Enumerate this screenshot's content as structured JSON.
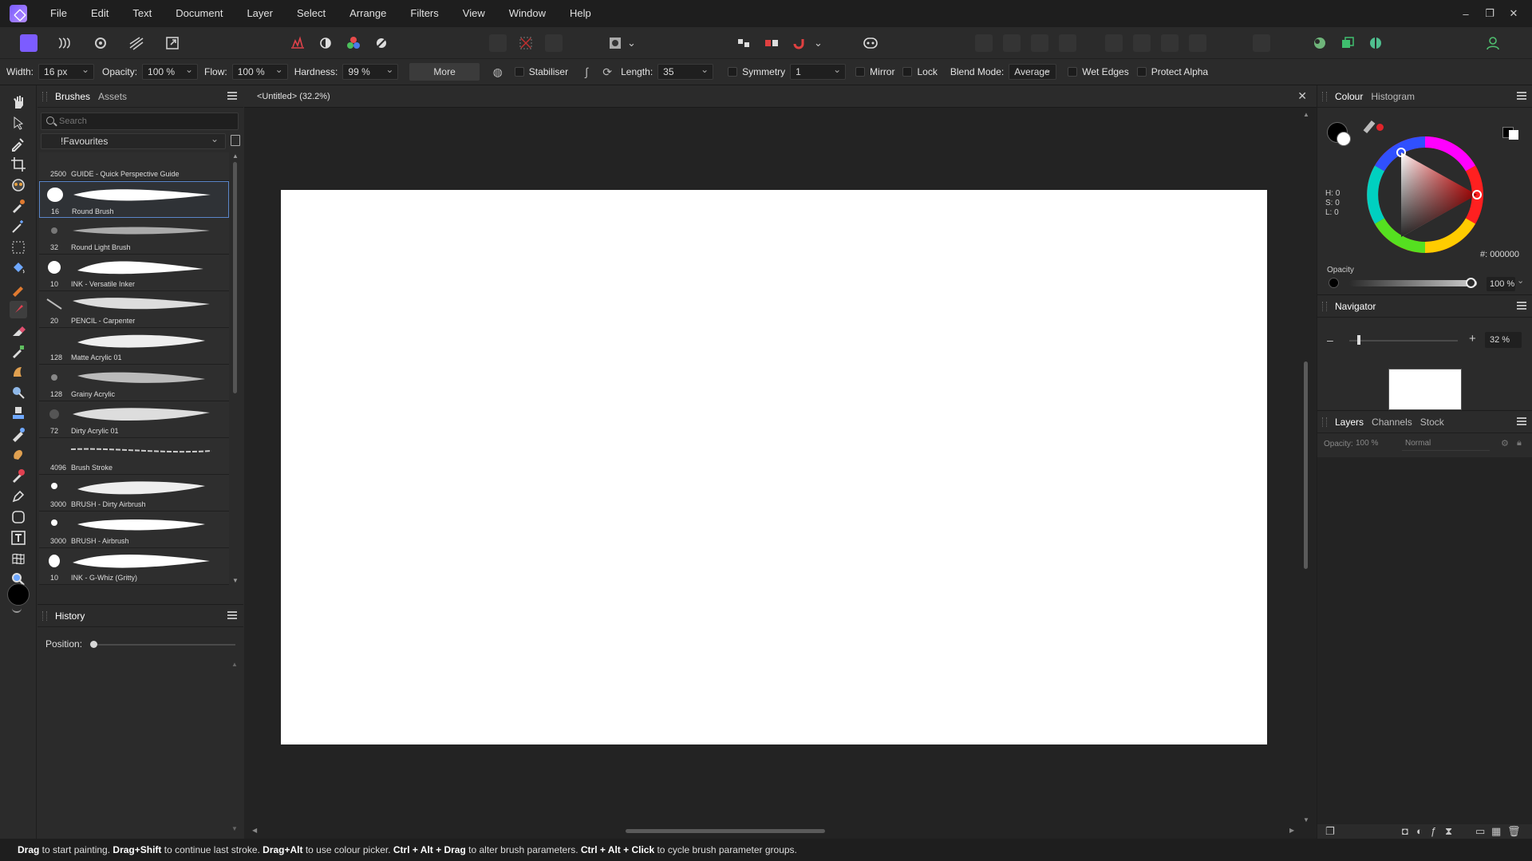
{
  "menu": {
    "items": [
      "File",
      "Edit",
      "Text",
      "Document",
      "Layer",
      "Select",
      "Arrange",
      "Filters",
      "View",
      "Window",
      "Help"
    ]
  },
  "window_controls": {
    "minimize": "–",
    "maximize": "❐",
    "close": "✕"
  },
  "context": {
    "width_label": "Width:",
    "width_value": "16 px",
    "opacity_label": "Opacity:",
    "opacity_value": "100 %",
    "flow_label": "Flow:",
    "flow_value": "100 %",
    "hardness_label": "Hardness:",
    "hardness_value": "99 %",
    "more_label": "More",
    "stabiliser_label": "Stabiliser",
    "length_label": "Length:",
    "length_value": "35",
    "symmetry_label": "Symmetry",
    "symmetry_value": "1",
    "mirror_label": "Mirror",
    "lock_label": "Lock",
    "blend_label": "Blend Mode:",
    "blend_value": "Average",
    "wet_edges_label": "Wet Edges",
    "protect_alpha_label": "Protect Alpha"
  },
  "brushes_panel": {
    "tab_brushes": "Brushes",
    "tab_assets": "Assets",
    "search_placeholder": "Search",
    "category": "!Favourites",
    "items": [
      {
        "size": "2500",
        "name": "GUIDE - Quick Perspective Guide"
      },
      {
        "size": "16",
        "name": "Round Brush"
      },
      {
        "size": "32",
        "name": "Round Light Brush"
      },
      {
        "size": "10",
        "name": "INK - Versatile Inker"
      },
      {
        "size": "20",
        "name": "PENCIL - Carpenter"
      },
      {
        "size": "128",
        "name": "Matte Acrylic 01"
      },
      {
        "size": "128",
        "name": "Grainy Acrylic"
      },
      {
        "size": "72",
        "name": "Dirty Acrylic 01"
      },
      {
        "size": "4096",
        "name": "Brush Stroke"
      },
      {
        "size": "3000",
        "name": "BRUSH - Dirty Airbrush"
      },
      {
        "size": "3000",
        "name": "BRUSH - Airbrush"
      },
      {
        "size": "10",
        "name": "INK - G-Whiz (Gritty)"
      }
    ]
  },
  "history_panel": {
    "title": "History",
    "position_label": "Position:"
  },
  "document": {
    "tab_title": "<Untitled> (32.2%)",
    "close": "✕"
  },
  "colour_panel": {
    "tab_colour": "Colour",
    "tab_histogram": "Histogram",
    "h": "H: 0",
    "s": "S: 0",
    "l": "L: 0",
    "hex": "#: 000000",
    "opacity_label": "Opacity",
    "opacity_value": "100 %",
    "primary_color": "#000000",
    "accent_color": "#e0242a"
  },
  "navigator_panel": {
    "title": "Navigator",
    "zoom_value": "32 %"
  },
  "layers_panel": {
    "tab_layers": "Layers",
    "tab_channels": "Channels",
    "tab_stock": "Stock",
    "opacity_label": "Opacity:",
    "opacity_value": "100 %",
    "blend_value": "Normal"
  },
  "status": {
    "k1": "Drag",
    "t1": " to start painting. ",
    "k2": "Drag+Shift",
    "t2": " to continue last stroke. ",
    "k3": "Drag+Alt",
    "t3": " to use colour picker. ",
    "k4": "Ctrl + Alt + Drag",
    "t4": " to alter brush parameters. ",
    "k5": "Ctrl + Alt + Click",
    "t5": " to cycle brush parameter groups."
  }
}
